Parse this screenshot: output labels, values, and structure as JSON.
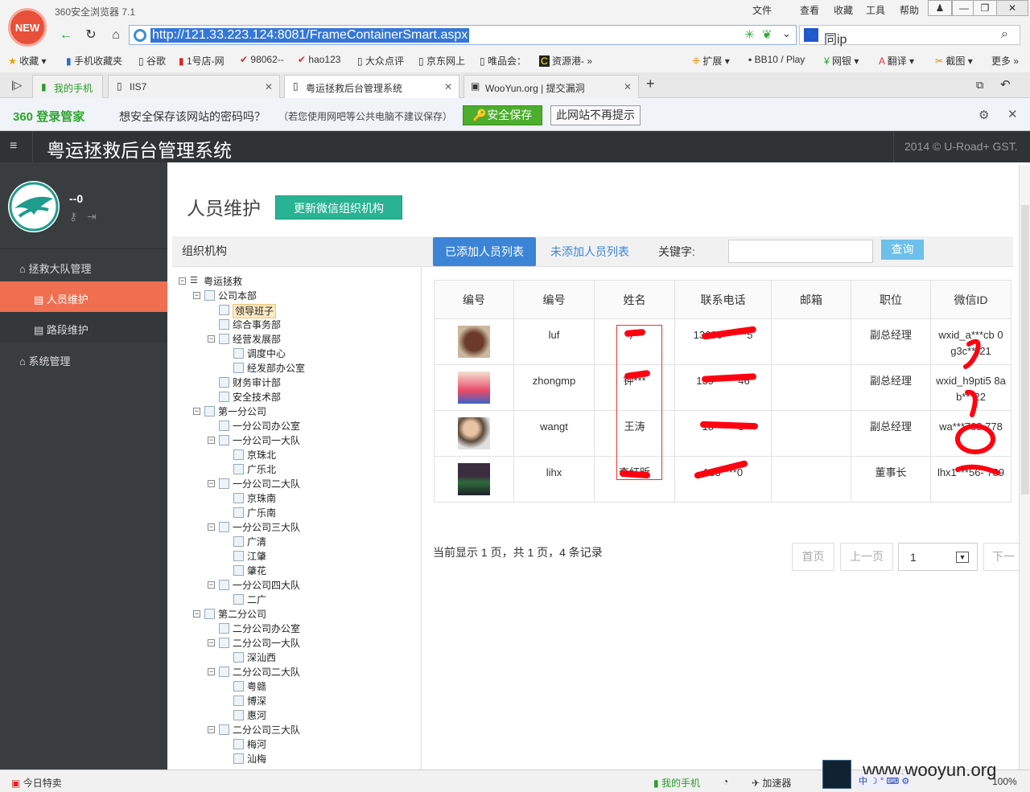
{
  "browser": {
    "logo_badge": "NEW",
    "app_title": "360安全浏览器 7.1",
    "menus": [
      "文件",
      "查看",
      "收藏",
      "工具",
      "帮助"
    ],
    "url": "http://121.33.223.124:8081/FrameContainerSmart.aspx",
    "search_text": "同ip",
    "bookmarks": [
      "收藏",
      "手机收藏夹",
      "谷歌",
      "1号店-网",
      "98062--",
      "hao123",
      "大众点评",
      "京东网上",
      "唯品会：",
      "资源港-"
    ],
    "right_tools": [
      "扩展",
      "BB10 / Play",
      "网银",
      "翻译",
      "截图",
      "更多"
    ],
    "tabs": [
      {
        "label": "我的手机"
      },
      {
        "label": "IIS7"
      },
      {
        "label": "粤运拯救后台管理系统",
        "active": true
      },
      {
        "label": "WooYun.org | 提交漏洞"
      }
    ]
  },
  "password_bar": {
    "brand": "360",
    "brand_label": "登录管家",
    "question": "想安全保存该网站的密码吗？",
    "note": "（若您使用网吧等公共电脑不建议保存）",
    "save_label": "安全保存",
    "never_label": "此网站不再提示"
  },
  "app": {
    "name": "粤运拯救后台管理系统",
    "copyright": "2014 © U-Road+ GST.",
    "user": "--0",
    "sidebar": [
      {
        "label": "拯救大队管理",
        "level": 0
      },
      {
        "label": "人员维护",
        "level": 1,
        "active": true
      },
      {
        "label": "路段维护",
        "level": 1
      },
      {
        "label": "系统管理",
        "level": 0
      }
    ],
    "page_title": "人员维护",
    "wechat_button": "更新微信组织机构",
    "org_title": "组织机构",
    "tree": [
      {
        "label": "粤运拯救",
        "depth": 0,
        "expander": "-"
      },
      {
        "label": "公司本部",
        "depth": 1,
        "expander": "-"
      },
      {
        "label": "领导班子",
        "depth": 2,
        "selected": true
      },
      {
        "label": "综合事务部",
        "depth": 2
      },
      {
        "label": "经营发展部",
        "depth": 2,
        "expander": "-"
      },
      {
        "label": "调度中心",
        "depth": 3
      },
      {
        "label": "经发部办公室",
        "depth": 3
      },
      {
        "label": "财务审计部",
        "depth": 2
      },
      {
        "label": "安全技术部",
        "depth": 2
      },
      {
        "label": "第一分公司",
        "depth": 1,
        "expander": "-"
      },
      {
        "label": "一分公司办公室",
        "depth": 2
      },
      {
        "label": "一分公司一大队",
        "depth": 2,
        "expander": "-"
      },
      {
        "label": "京珠北",
        "depth": 3
      },
      {
        "label": "广乐北",
        "depth": 3
      },
      {
        "label": "一分公司二大队",
        "depth": 2,
        "expander": "-"
      },
      {
        "label": "京珠南",
        "depth": 3
      },
      {
        "label": "广乐南",
        "depth": 3
      },
      {
        "label": "一分公司三大队",
        "depth": 2,
        "expander": "-"
      },
      {
        "label": "广清",
        "depth": 3
      },
      {
        "label": "江肇",
        "depth": 3
      },
      {
        "label": "肇花",
        "depth": 3
      },
      {
        "label": "一分公司四大队",
        "depth": 2,
        "expander": "-"
      },
      {
        "label": "二广",
        "depth": 3
      },
      {
        "label": "第二分公司",
        "depth": 1,
        "expander": "-"
      },
      {
        "label": "二分公司办公室",
        "depth": 2
      },
      {
        "label": "二分公司一大队",
        "depth": 2,
        "expander": "-"
      },
      {
        "label": "深汕西",
        "depth": 3
      },
      {
        "label": "二分公司二大队",
        "depth": 2,
        "expander": "-"
      },
      {
        "label": "粤赣",
        "depth": 3
      },
      {
        "label": "博深",
        "depth": 3
      },
      {
        "label": "惠河",
        "depth": 3
      },
      {
        "label": "二分公司三大队",
        "depth": 2,
        "expander": "-"
      },
      {
        "label": "梅河",
        "depth": 3
      },
      {
        "label": "汕梅",
        "depth": 3
      }
    ],
    "tab_added": "已添加人员列表",
    "tab_not_added": "未添加人员列表",
    "keyword_label": "关键字:",
    "query_button": "查询",
    "table": {
      "headers": [
        "编号",
        "编号",
        "姓名",
        "联系电话",
        "邮箱",
        "职位",
        "微信ID"
      ],
      "rows": [
        {
          "photo": "dog-photo",
          "code": "luf",
          "name": "卢",
          "phone": "13600******5",
          "email": "",
          "position": "副总经理",
          "wechat": "wxid_a***cb 0g3c***21"
        },
        {
          "photo": "child-photo",
          "code": "zhongmp",
          "name": "钟***",
          "phone": "139******46",
          "email": "",
          "position": "副总经理",
          "wechat": "wxid_h9pti5 8ab***22"
        },
        {
          "photo": "family-photo",
          "code": "wangt",
          "name": "王涛",
          "phone": "18******3",
          "email": "",
          "position": "副总经理",
          "wechat": "wa***768 778"
        },
        {
          "photo": "stadium-photo",
          "code": "lihx",
          "name": "李红昕",
          "phone": "133****0",
          "email": "",
          "position": "董事长",
          "wechat": "lhx1***56- 789"
        }
      ]
    },
    "pager": {
      "info": "当前显示 1 页，共 1 页，4 条记录",
      "first": "首页",
      "prev": "上一页",
      "current": "1",
      "next": "下一"
    }
  },
  "statusbar": {
    "left": "今日特卖",
    "phone": "我的手机",
    "accel": "加速器",
    "zoom": "100%",
    "watermark": "www.wooyun.org"
  }
}
